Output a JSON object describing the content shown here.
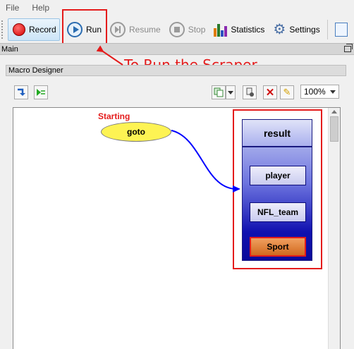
{
  "menubar": {
    "items": [
      "File",
      "Help"
    ]
  },
  "toolbar": {
    "record": "Record",
    "run": "Run",
    "resume": "Resume",
    "stop": "Stop",
    "statistics": "Statistics",
    "settings": "Settings"
  },
  "annotation": {
    "text": "To Run the Scraper"
  },
  "panel": {
    "title": "Main"
  },
  "designer": {
    "title": "Macro Designer",
    "zoom": "100%",
    "starting_label": "Starting",
    "start_node": "goto",
    "result_node": {
      "title": "result",
      "fields": [
        "player",
        "NFL_team",
        "Sport"
      ]
    }
  },
  "colors": {
    "annotation_red": "#e41b1b",
    "goto_yellow": "#fdf353",
    "result_blue": "#1111b0",
    "sport_orange": "#d2691e",
    "connector_blue": "#0000ff"
  }
}
